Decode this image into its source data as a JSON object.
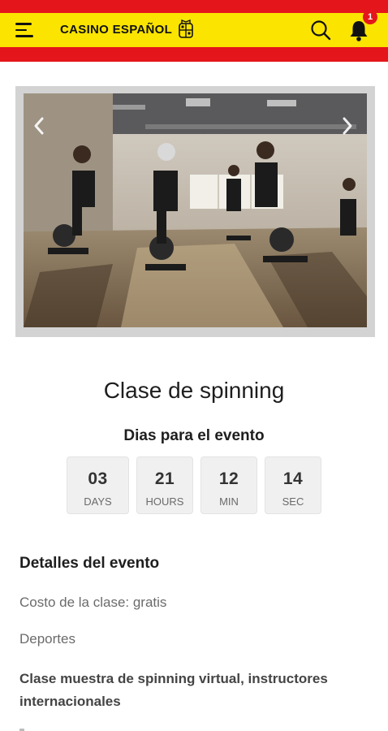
{
  "header": {
    "brand": "CASINO ESPAÑOL",
    "notification_count": "1",
    "colors": {
      "red": "#e4161b",
      "yellow": "#fbe400"
    }
  },
  "carousel": {
    "image_alt": "Spinning class photo",
    "current_slide": 1
  },
  "event": {
    "title": "Clase de spinning",
    "countdown_label": "Dias para el evento",
    "countdown": [
      {
        "value": "03",
        "unit": "DAYS"
      },
      {
        "value": "21",
        "unit": "HOURS"
      },
      {
        "value": "12",
        "unit": "MIN"
      },
      {
        "value": "14",
        "unit": "SEC"
      }
    ],
    "details_heading": "Detalles del evento",
    "cost": "Costo de la clase: gratis",
    "category": "Deportes",
    "description": "Clase muestra de spinning virtual, instructores internacionales"
  },
  "icons": [
    "menu-icon",
    "crest-icon",
    "search-icon",
    "bell-icon",
    "chevron-left-icon",
    "chevron-right-icon"
  ]
}
